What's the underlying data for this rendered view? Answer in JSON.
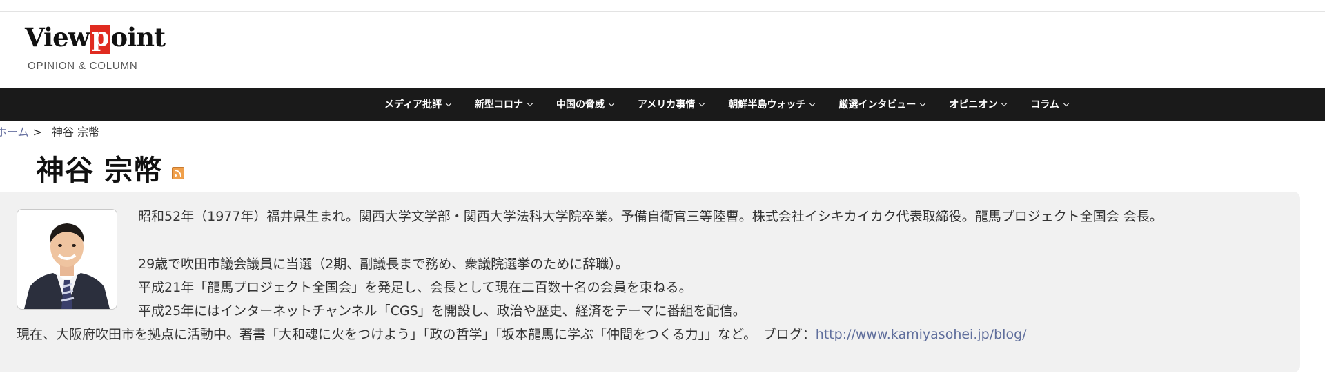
{
  "logo": {
    "word_before": "View",
    "word_highlight": "p",
    "word_after": "oint",
    "subtitle": "OPINION & COLUMN",
    "accent_color": "#e02b20"
  },
  "nav": {
    "items": [
      {
        "label": "メディア批評"
      },
      {
        "label": "新型コロナ"
      },
      {
        "label": "中国の脅威"
      },
      {
        "label": "アメリカ事情"
      },
      {
        "label": "朝鮮半島ウォッチ"
      },
      {
        "label": "厳選インタビュー"
      },
      {
        "label": "オピニオン"
      },
      {
        "label": "コラム"
      }
    ]
  },
  "breadcrumb": {
    "home": "ホーム",
    "separator": ">",
    "current": "神谷 宗幣"
  },
  "author": {
    "name": "神谷 宗幣",
    "rss_icon": "rss-feed-icon"
  },
  "bio": {
    "line1": "昭和52年（1977年）福井県生まれ。関西大学文学部・関西大学法科大学院卒業。予備自衛官三等陸曹。株式会社イシキカイカク代表取締役。龍馬プロジェクト全国会 会長。",
    "line2": "29歳で吹田市議会議員に当選（2期、副議長まで務め、衆議院選挙のために辞職）。",
    "line3": "平成21年「龍馬プロジェクト全国会」を発足し、会長として現在二百数十名の会員を束ねる。",
    "line4": "平成25年にはインターネットチャンネル「CGS」を開設し、政治や歴史、経済をテーマに番組を配信。",
    "line5": "現在、大阪府吹田市を拠点に活動中。著書「大和魂に火をつけよう」「政の哲学」「坂本龍馬に学ぶ「仲間をつくる力」」など。　ブログ：",
    "blog_url": "http://www.kamiyasohei.jp/blog/"
  }
}
